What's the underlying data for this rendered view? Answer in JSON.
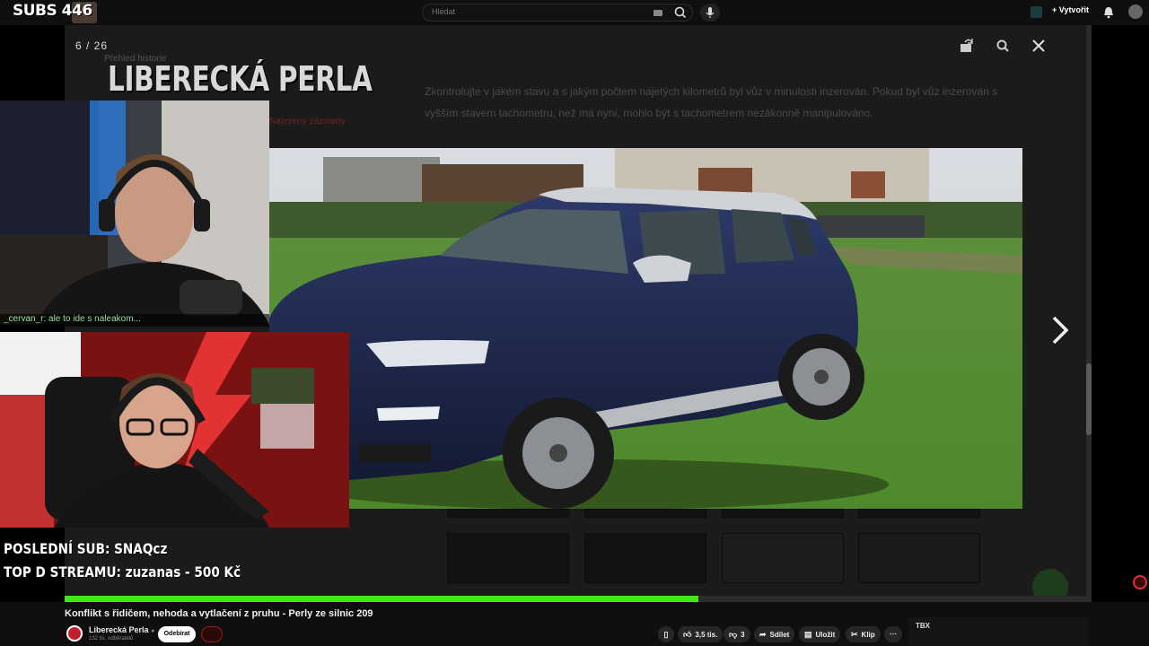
{
  "overlay": {
    "subs_counter": "SUBS 446",
    "brand_title": "LIBERECKÁ PERLA",
    "chat_line": "_cervan_r: ale to ide s naleakom...",
    "last_sub": "POSLEDNÍ SUB: SNAQcz",
    "top_donation": "TOP D STREAMU: zuzanas - 500 Kč"
  },
  "topbar": {
    "search_placeholder": "Hledat",
    "create_label": "Vytvořit"
  },
  "background_page": {
    "history_title": "Přehled historie",
    "article_text": "Zkontrolujte v jakém stavu a s jakým počtem najetých kilometrů byl vůz v minulosti inzerován. Pokud byl vůz inzerován s vyšším stavem tachometru, než má nyní, mohlo být s tachometrem nezákonně manipulováno.",
    "red_link": "Nalezeny záznamy"
  },
  "lightbox": {
    "counter": "6 / 26",
    "current": 6,
    "total": 26
  },
  "player": {
    "progress_fraction": 0.617
  },
  "video": {
    "title": "Konflikt s řidičem, nehoda a vytlačení z pruhu - Perly ze silnic 209",
    "channel_name": "Liberecká Perla",
    "channel_subs": "132 tis. odběratelů",
    "subscribe_label": "Odebírat",
    "likes": "3,5 tis.",
    "dislikes": "3",
    "share_label": "Sdílet",
    "save_label": "Uložit",
    "clip_label": "Klip"
  },
  "colors": {
    "progress": "#44e51e",
    "brand_red": "#c21d2a"
  }
}
